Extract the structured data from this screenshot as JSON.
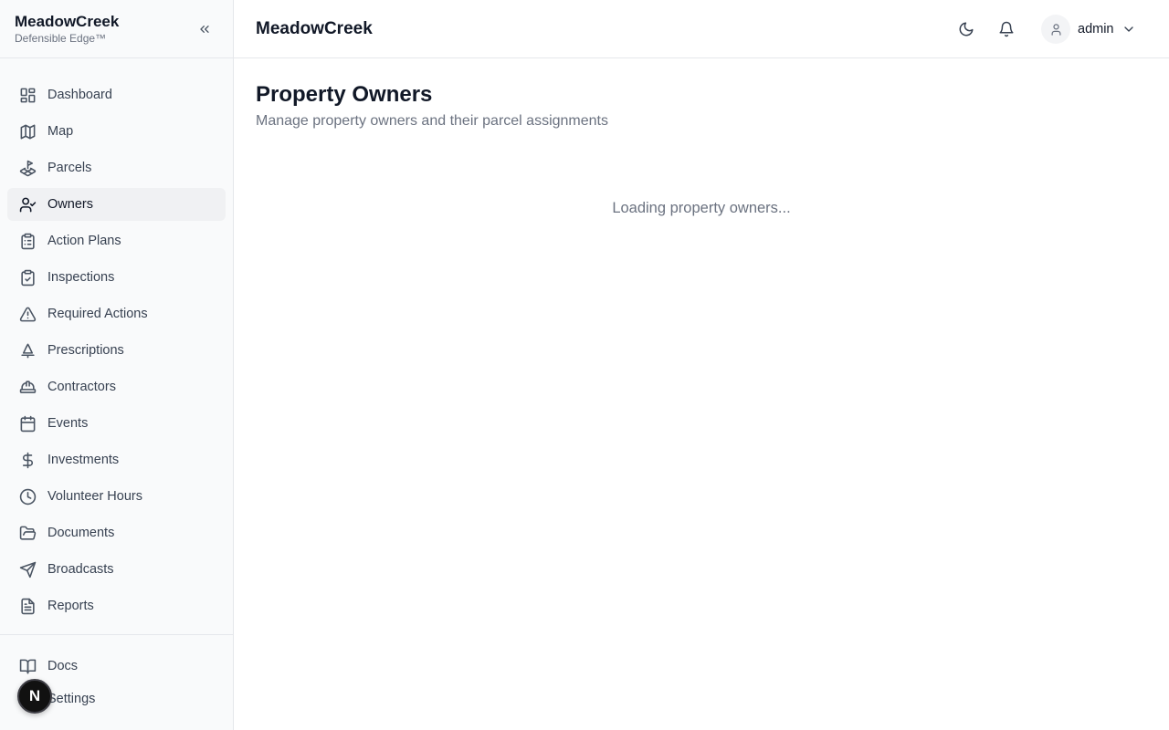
{
  "brand": {
    "name": "MeadowCreek",
    "tagline": "Defensible Edge™"
  },
  "sidebar": {
    "collapse_icon": "chevrons-left-icon",
    "items": [
      {
        "label": "Dashboard",
        "icon": "layout-dashboard-icon"
      },
      {
        "label": "Map",
        "icon": "map-icon"
      },
      {
        "label": "Parcels",
        "icon": "land-plot-icon"
      },
      {
        "label": "Owners",
        "icon": "user-check-icon",
        "active": true
      },
      {
        "label": "Action Plans",
        "icon": "clipboard-list-icon"
      },
      {
        "label": "Inspections",
        "icon": "clipboard-check-icon"
      },
      {
        "label": "Required Actions",
        "icon": "alert-triangle-icon"
      },
      {
        "label": "Prescriptions",
        "icon": "tree-icon"
      },
      {
        "label": "Contractors",
        "icon": "hard-hat-icon"
      },
      {
        "label": "Events",
        "icon": "calendar-icon"
      },
      {
        "label": "Investments",
        "icon": "dollar-sign-icon"
      },
      {
        "label": "Volunteer Hours",
        "icon": "clock-icon"
      },
      {
        "label": "Documents",
        "icon": "folder-open-icon"
      },
      {
        "label": "Broadcasts",
        "icon": "send-icon"
      },
      {
        "label": "Reports",
        "icon": "file-text-icon"
      }
    ],
    "bottom_items": [
      {
        "label": "Docs",
        "icon": "book-open-icon"
      },
      {
        "label": "Settings",
        "icon": "settings-icon"
      }
    ]
  },
  "header": {
    "title": "MeadowCreek",
    "theme_icon": "moon-icon",
    "notifications_icon": "bell-icon",
    "user": {
      "name": "admin",
      "avatar_icon": "user-icon",
      "menu_icon": "chevron-down-icon"
    }
  },
  "main": {
    "title": "Property Owners",
    "subtitle": "Manage property owners and their parcel assignments",
    "loading_text": "Loading property owners..."
  },
  "floating_button": {
    "label": "N"
  },
  "colors": {
    "sidebar_bg": "#f9fafb",
    "active_item_bg": "#f0f1f3",
    "border": "#e5e7eb",
    "muted_text": "#6b7280"
  }
}
